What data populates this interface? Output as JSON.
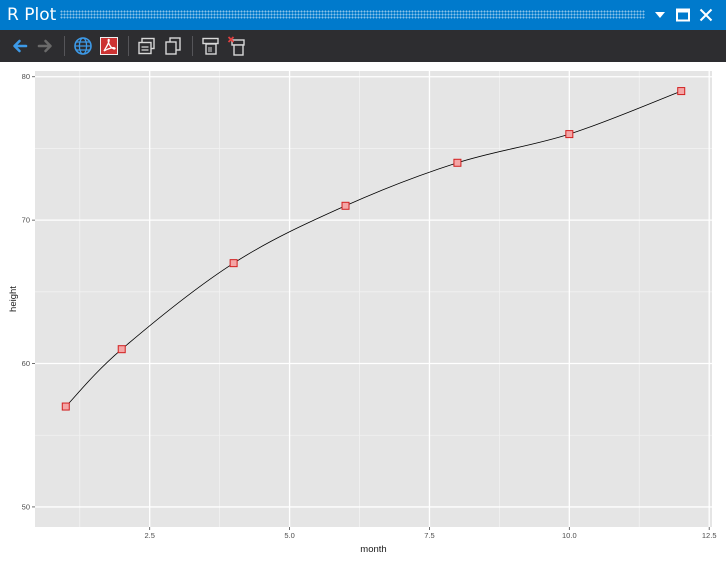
{
  "window": {
    "title": "R Plot",
    "controls": [
      "dropdown-icon",
      "maximize-icon",
      "close-icon"
    ]
  },
  "toolbar": {
    "items": [
      "back-arrow-icon",
      "forward-arrow-icon",
      "globe-icon",
      "pdf-icon",
      "copy-bitmap-icon",
      "copy-metafile-icon",
      "export-plot-icon",
      "remove-plot-icon"
    ]
  },
  "colors": {
    "titlebar": "#007acc",
    "toolbar": "#2d2d30",
    "panel": "#e5e5e5",
    "gridline": "#ffffff",
    "marker_fill": "#f4a6a6",
    "marker_stroke": "#d21f1f",
    "line": "#000000"
  },
  "chart_data": {
    "type": "line",
    "xlabel": "month",
    "ylabel": "height",
    "x": [
      1,
      2,
      4,
      6,
      8,
      10,
      12
    ],
    "y": [
      57,
      61,
      67,
      71,
      74,
      76,
      79
    ],
    "xlim": [
      0.45,
      12.55
    ],
    "ylim": [
      48.6,
      80.4
    ],
    "xticks": [
      2.5,
      5.0,
      7.5,
      10.0,
      12.5
    ],
    "xtick_labels": [
      "2.5",
      "5.0",
      "7.5",
      "10.0",
      "12.5"
    ],
    "yticks": [
      50,
      60,
      70,
      80
    ],
    "ytick_labels": [
      "50",
      "60",
      "70",
      "80"
    ],
    "grid": true,
    "marker": "square",
    "line_style": "smooth"
  }
}
